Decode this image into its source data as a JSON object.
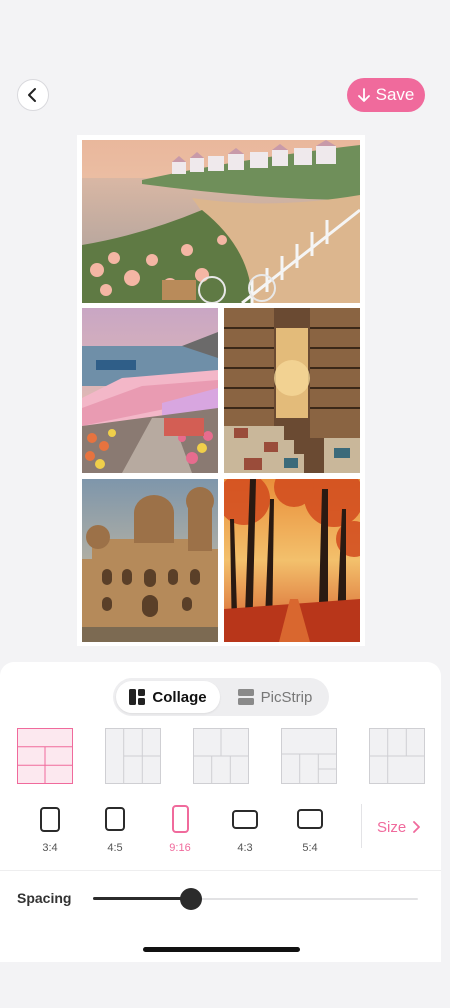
{
  "header": {
    "back_icon": "chevron-left-icon",
    "save_label": "Save",
    "save_icon": "arrow-down-icon",
    "accent_color": "#f06a9c"
  },
  "collage": {
    "photos": [
      {
        "name": "coastal-village-with-flowers-and-bicycle"
      },
      {
        "name": "seaside-flower-market"
      },
      {
        "name": "old-bookshop-interior"
      },
      {
        "name": "ornate-palace-at-sunset"
      },
      {
        "name": "autumn-forest-path"
      }
    ]
  },
  "panel": {
    "tabs": [
      {
        "label": "Collage",
        "icon": "collage-icon",
        "active": true
      },
      {
        "label": "PicStrip",
        "icon": "picstrip-icon",
        "active": false
      }
    ],
    "layouts": [
      {
        "name": "layout-1",
        "selected": true
      },
      {
        "name": "layout-2",
        "selected": false
      },
      {
        "name": "layout-3",
        "selected": false
      },
      {
        "name": "layout-4",
        "selected": false
      },
      {
        "name": "layout-5",
        "selected": false
      }
    ],
    "ratios": [
      {
        "label": "3:4",
        "active": false
      },
      {
        "label": "4:5",
        "active": false
      },
      {
        "label": "9:16",
        "active": true
      },
      {
        "label": "4:3",
        "active": false
      },
      {
        "label": "5:4",
        "active": false
      }
    ],
    "size_label": "Size",
    "size_icon": "chevron-right-icon",
    "spacing_label": "Spacing",
    "spacing_value": 0.3
  }
}
